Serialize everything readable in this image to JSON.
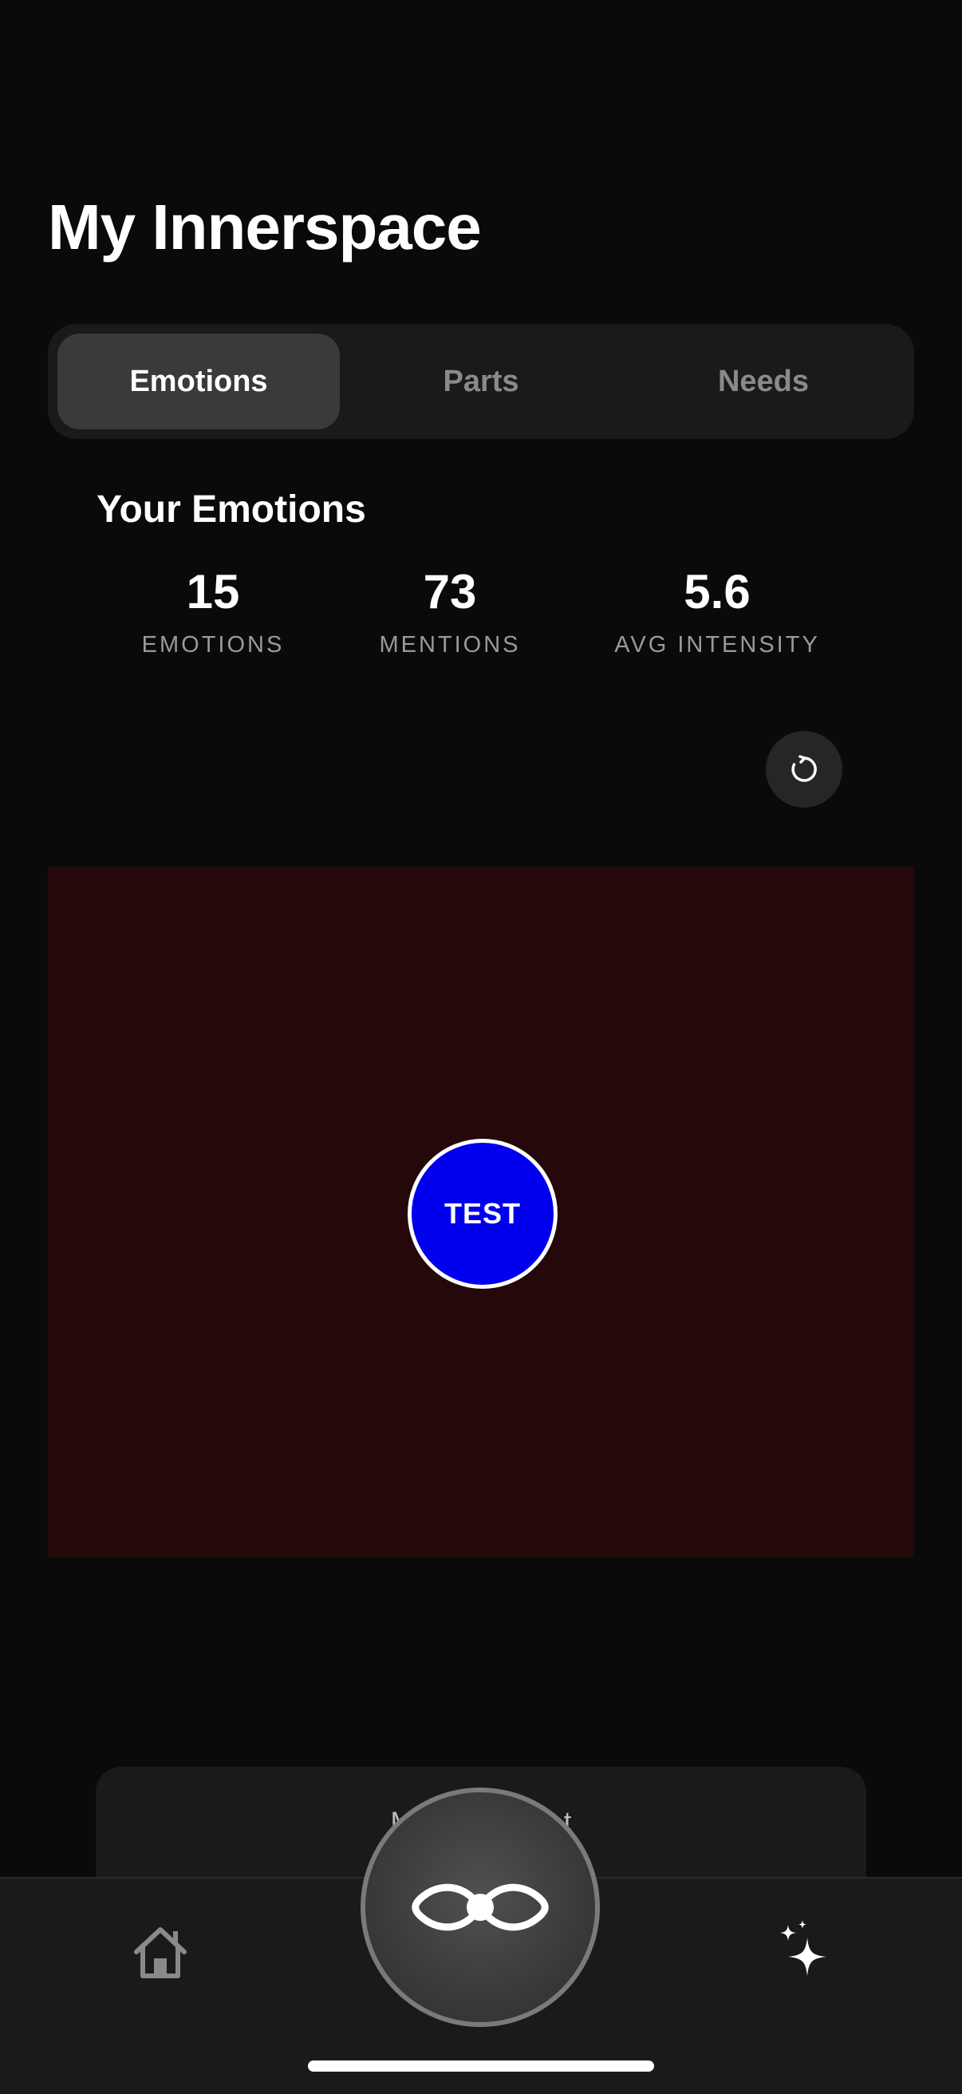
{
  "header": {
    "title": "My Innerspace"
  },
  "tabs": [
    {
      "label": "Emotions",
      "active": true
    },
    {
      "label": "Parts",
      "active": false
    },
    {
      "label": "Needs",
      "active": false
    }
  ],
  "summary": {
    "title": "Your Emotions",
    "stats": [
      {
        "value": "15",
        "label": "EMOTIONS"
      },
      {
        "value": "73",
        "label": "MENTIONS"
      },
      {
        "value": "5.6",
        "label": "AVG INTENSITY"
      }
    ]
  },
  "toolbar": {
    "refresh_icon": "refresh-icon"
  },
  "canvas": {
    "background": "#24080a",
    "bubble_label": "TEST",
    "bubble_color": "#0000ee"
  },
  "bottom_card": {
    "label": "M                    t"
  },
  "tab_bar": {
    "home_icon": "home-icon",
    "center_icon": "infinity-eye-icon",
    "sparkle_icon": "sparkle-icon"
  }
}
